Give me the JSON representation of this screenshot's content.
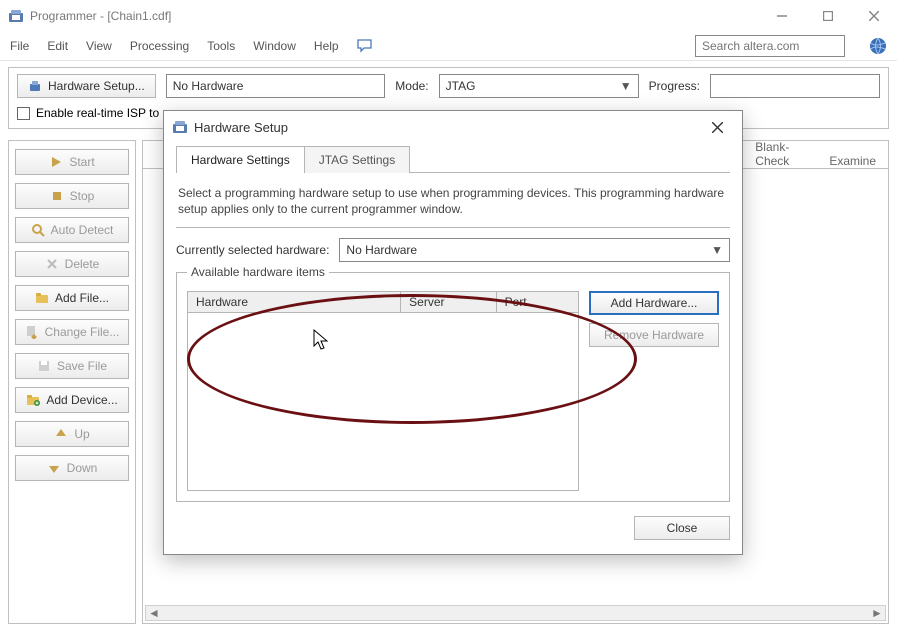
{
  "window": {
    "title": "Programmer - [Chain1.cdf]"
  },
  "menu": {
    "items": [
      "File",
      "Edit",
      "View",
      "Processing",
      "Tools",
      "Window",
      "Help"
    ],
    "search_placeholder": "Search altera.com"
  },
  "toolbar": {
    "hardware_setup_btn": "Hardware Setup...",
    "hardware_field": "No Hardware",
    "mode_label": "Mode:",
    "mode_value": "JTAG",
    "progress_label": "Progress:",
    "isp_checkbox_label": "Enable real-time ISP to"
  },
  "side": {
    "buttons": [
      {
        "label": "Start",
        "enabled": false
      },
      {
        "label": "Stop",
        "enabled": false
      },
      {
        "label": "Auto Detect",
        "enabled": false
      },
      {
        "label": "Delete",
        "enabled": false
      },
      {
        "label": "Add File...",
        "enabled": true
      },
      {
        "label": "Change File...",
        "enabled": false
      },
      {
        "label": "Save File",
        "enabled": false
      },
      {
        "label": "Add Device...",
        "enabled": true
      },
      {
        "label": "Up",
        "enabled": false
      },
      {
        "label": "Down",
        "enabled": false
      }
    ]
  },
  "main_tabs": {
    "blank_check": "Blank-\nCheck",
    "examine": "Examine"
  },
  "dialog": {
    "title": "Hardware Setup",
    "tabs": {
      "hw": "Hardware Settings",
      "jtag": "JTAG Settings"
    },
    "description": "Select a programming hardware setup to use when programming devices. This programming hardware setup applies only to the current programmer window.",
    "cs_label": "Currently selected hardware:",
    "cs_value": "No Hardware",
    "group_title": "Available hardware items",
    "cols": {
      "hw": "Hardware",
      "srv": "Server",
      "port": "Port"
    },
    "add_btn": "Add Hardware...",
    "remove_btn": "Remove Hardware",
    "close_btn": "Close"
  }
}
